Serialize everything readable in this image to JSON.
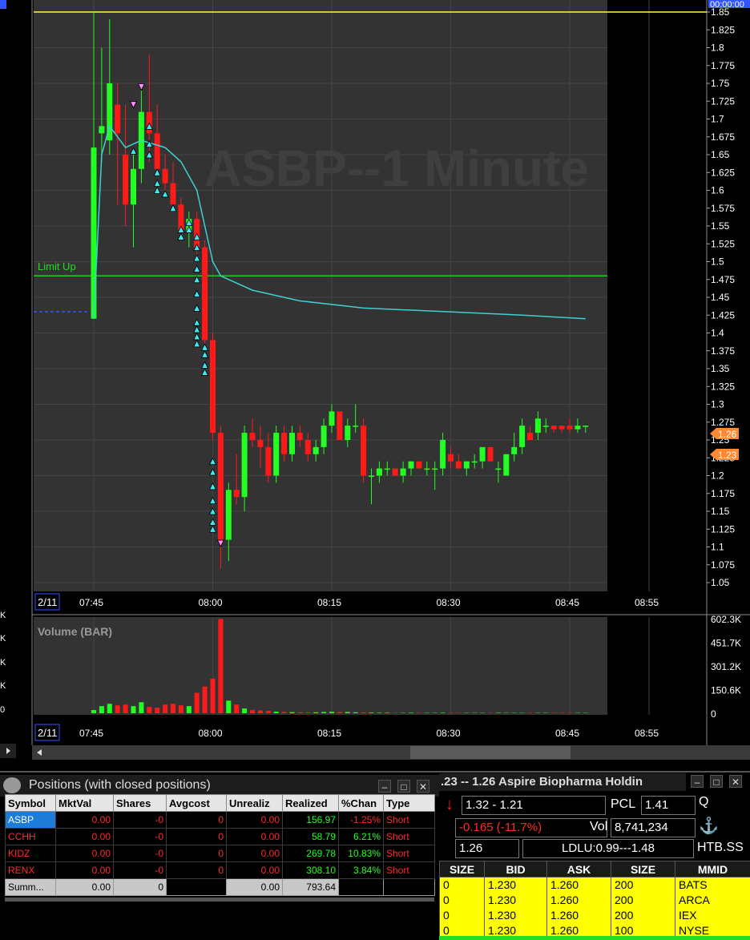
{
  "chart": {
    "title_watermark": "ASBP--1 Minute",
    "top_timestamp": "00:00:00",
    "date_label": "2/11",
    "limit_up_label": "Limit Up",
    "limit_up_price": 1.48,
    "top_yellow_price": 1.85,
    "time_labels": [
      "07:45",
      "08:00",
      "08:15",
      "08:30",
      "08:45",
      "08:55"
    ],
    "price_ticks": [
      "1.85",
      "1.825",
      "1.8",
      "1.775",
      "1.75",
      "1.725",
      "1.7",
      "1.675",
      "1.65",
      "1.625",
      "1.6",
      "1.575",
      "1.55",
      "1.525",
      "1.5",
      "1.475",
      "1.45",
      "1.425",
      "1.4",
      "1.375",
      "1.35",
      "1.325",
      "1.3",
      "1.275",
      "1.25",
      "1.225",
      "1.2",
      "1.175",
      "1.15",
      "1.125",
      "1.1",
      "1.075",
      "1.05"
    ],
    "bid_tag": "1.26",
    "ask_tag": "1.23",
    "volume_label": "Volume (BAR)",
    "volume_ticks": [
      "602.3K",
      "451.7K",
      "301.2K",
      "150.6K",
      "0"
    ],
    "left_edge_labels": [
      "K",
      "K",
      "K",
      "K",
      "0"
    ],
    "colors": {
      "up": "#22ff22",
      "down": "#ff1a1a",
      "vwap": "#40d0d0",
      "limit": "#22cc22",
      "yellow": "#ffff33",
      "bg": "#333333"
    }
  },
  "chart_data": {
    "type": "candlestick",
    "x_unit": "minutes after 07:45",
    "candles": [
      {
        "x": 0,
        "o": 1.42,
        "h": 1.85,
        "l": 1.42,
        "c": 1.66
      },
      {
        "x": 1,
        "o": 1.68,
        "h": 1.8,
        "l": 1.64,
        "c": 1.69
      },
      {
        "x": 2,
        "o": 1.67,
        "h": 1.84,
        "l": 1.65,
        "c": 1.75
      },
      {
        "x": 3,
        "o": 1.72,
        "h": 1.75,
        "l": 1.58,
        "c": 1.68
      },
      {
        "x": 4,
        "o": 1.65,
        "h": 1.72,
        "l": 1.55,
        "c": 1.58
      },
      {
        "x": 5,
        "o": 1.58,
        "h": 1.65,
        "l": 1.52,
        "c": 1.63
      },
      {
        "x": 6,
        "o": 1.63,
        "h": 1.74,
        "l": 1.61,
        "c": 1.71
      },
      {
        "x": 7,
        "o": 1.71,
        "h": 1.79,
        "l": 1.64,
        "c": 1.68
      },
      {
        "x": 8,
        "o": 1.68,
        "h": 1.72,
        "l": 1.62,
        "c": 1.63
      },
      {
        "x": 9,
        "o": 1.63,
        "h": 1.65,
        "l": 1.59,
        "c": 1.61
      },
      {
        "x": 10,
        "o": 1.61,
        "h": 1.64,
        "l": 1.57,
        "c": 1.58
      },
      {
        "x": 11,
        "o": 1.58,
        "h": 1.59,
        "l": 1.53,
        "c": 1.54
      },
      {
        "x": 12,
        "o": 1.54,
        "h": 1.57,
        "l": 1.52,
        "c": 1.56
      },
      {
        "x": 13,
        "o": 1.56,
        "h": 1.57,
        "l": 1.51,
        "c": 1.52
      },
      {
        "x": 14,
        "o": 1.52,
        "h": 1.53,
        "l": 1.38,
        "c": 1.39
      },
      {
        "x": 15,
        "o": 1.39,
        "h": 1.4,
        "l": 1.25,
        "c": 1.26
      },
      {
        "x": 16,
        "o": 1.26,
        "h": 1.27,
        "l": 1.07,
        "c": 1.11
      },
      {
        "x": 17,
        "o": 1.11,
        "h": 1.19,
        "l": 1.08,
        "c": 1.18
      },
      {
        "x": 18,
        "o": 1.18,
        "h": 1.23,
        "l": 1.16,
        "c": 1.17
      },
      {
        "x": 19,
        "o": 1.17,
        "h": 1.27,
        "l": 1.15,
        "c": 1.26
      },
      {
        "x": 20,
        "o": 1.26,
        "h": 1.28,
        "l": 1.24,
        "c": 1.25
      },
      {
        "x": 21,
        "o": 1.25,
        "h": 1.27,
        "l": 1.21,
        "c": 1.24
      },
      {
        "x": 22,
        "o": 1.24,
        "h": 1.26,
        "l": 1.19,
        "c": 1.2
      },
      {
        "x": 23,
        "o": 1.2,
        "h": 1.27,
        "l": 1.19,
        "c": 1.26
      },
      {
        "x": 24,
        "o": 1.26,
        "h": 1.27,
        "l": 1.22,
        "c": 1.23
      },
      {
        "x": 25,
        "o": 1.23,
        "h": 1.27,
        "l": 1.22,
        "c": 1.26
      },
      {
        "x": 26,
        "o": 1.26,
        "h": 1.27,
        "l": 1.24,
        "c": 1.25
      },
      {
        "x": 27,
        "o": 1.25,
        "h": 1.26,
        "l": 1.22,
        "c": 1.23
      },
      {
        "x": 28,
        "o": 1.23,
        "h": 1.25,
        "l": 1.22,
        "c": 1.24
      },
      {
        "x": 29,
        "o": 1.24,
        "h": 1.28,
        "l": 1.23,
        "c": 1.27
      },
      {
        "x": 30,
        "o": 1.27,
        "h": 1.3,
        "l": 1.26,
        "c": 1.29
      },
      {
        "x": 31,
        "o": 1.29,
        "h": 1.29,
        "l": 1.25,
        "c": 1.25
      },
      {
        "x": 32,
        "o": 1.25,
        "h": 1.28,
        "l": 1.24,
        "c": 1.27
      },
      {
        "x": 33,
        "o": 1.27,
        "h": 1.3,
        "l": 1.26,
        "c": 1.27
      },
      {
        "x": 34,
        "o": 1.27,
        "h": 1.28,
        "l": 1.19,
        "c": 1.2
      },
      {
        "x": 35,
        "o": 1.2,
        "h": 1.21,
        "l": 1.16,
        "c": 1.2
      },
      {
        "x": 36,
        "o": 1.2,
        "h": 1.22,
        "l": 1.19,
        "c": 1.21
      },
      {
        "x": 37,
        "o": 1.21,
        "h": 1.22,
        "l": 1.2,
        "c": 1.21
      },
      {
        "x": 38,
        "o": 1.21,
        "h": 1.21,
        "l": 1.2,
        "c": 1.2
      },
      {
        "x": 39,
        "o": 1.2,
        "h": 1.22,
        "l": 1.19,
        "c": 1.21
      },
      {
        "x": 40,
        "o": 1.21,
        "h": 1.22,
        "l": 1.2,
        "c": 1.22
      },
      {
        "x": 41,
        "o": 1.22,
        "h": 1.22,
        "l": 1.21,
        "c": 1.21
      },
      {
        "x": 42,
        "o": 1.21,
        "h": 1.22,
        "l": 1.2,
        "c": 1.21
      },
      {
        "x": 43,
        "o": 1.21,
        "h": 1.22,
        "l": 1.18,
        "c": 1.21
      },
      {
        "x": 44,
        "o": 1.21,
        "h": 1.26,
        "l": 1.2,
        "c": 1.25
      },
      {
        "x": 45,
        "o": 1.23,
        "h": 1.24,
        "l": 1.21,
        "c": 1.22
      },
      {
        "x": 46,
        "o": 1.22,
        "h": 1.23,
        "l": 1.21,
        "c": 1.21
      },
      {
        "x": 47,
        "o": 1.21,
        "h": 1.22,
        "l": 1.2,
        "c": 1.22
      },
      {
        "x": 48,
        "o": 1.22,
        "h": 1.23,
        "l": 1.21,
        "c": 1.22
      },
      {
        "x": 49,
        "o": 1.22,
        "h": 1.24,
        "l": 1.21,
        "c": 1.24
      },
      {
        "x": 50,
        "o": 1.24,
        "h": 1.24,
        "l": 1.22,
        "c": 1.22
      },
      {
        "x": 51,
        "o": 1.21,
        "h": 1.22,
        "l": 1.19,
        "c": 1.21
      },
      {
        "x": 52,
        "o": 1.2,
        "h": 1.23,
        "l": 1.2,
        "c": 1.23
      },
      {
        "x": 53,
        "o": 1.23,
        "h": 1.26,
        "l": 1.22,
        "c": 1.24
      },
      {
        "x": 54,
        "o": 1.24,
        "h": 1.28,
        "l": 1.23,
        "c": 1.27
      },
      {
        "x": 55,
        "o": 1.26,
        "h": 1.27,
        "l": 1.25,
        "c": 1.25
      },
      {
        "x": 56,
        "o": 1.26,
        "h": 1.29,
        "l": 1.25,
        "c": 1.28
      },
      {
        "x": 57,
        "o": 1.27,
        "h": 1.28,
        "l": 1.26,
        "c": 1.27
      },
      {
        "x": 58,
        "o": 1.27,
        "h": 1.27,
        "l": 1.26,
        "c": 1.265
      },
      {
        "x": 59,
        "o": 1.27,
        "h": 1.27,
        "l": 1.26,
        "c": 1.265
      },
      {
        "x": 60,
        "o": 1.27,
        "h": 1.28,
        "l": 1.26,
        "c": 1.265
      },
      {
        "x": 61,
        "o": 1.265,
        "h": 1.28,
        "l": 1.26,
        "c": 1.27
      },
      {
        "x": 62,
        "o": 1.27,
        "h": 1.27,
        "l": 1.26,
        "c": 1.27
      }
    ],
    "vwap": [
      [
        0,
        1.42
      ],
      [
        1,
        1.65
      ],
      [
        2,
        1.69
      ],
      [
        4,
        1.66
      ],
      [
        6,
        1.67
      ],
      [
        9,
        1.66
      ],
      [
        11,
        1.64
      ],
      [
        13,
        1.6
      ],
      [
        14,
        1.55
      ],
      [
        15,
        1.5
      ],
      [
        16,
        1.48
      ],
      [
        20,
        1.46
      ],
      [
        26,
        1.445
      ],
      [
        34,
        1.435
      ],
      [
        44,
        1.43
      ],
      [
        54,
        1.425
      ],
      [
        62,
        1.42
      ]
    ],
    "volume_k": [
      20,
      45,
      60,
      50,
      55,
      45,
      70,
      40,
      35,
      55,
      60,
      50,
      45,
      130,
      170,
      220,
      600,
      80,
      55,
      30,
      20,
      18,
      15,
      10,
      8,
      7,
      6,
      5,
      6,
      8,
      9,
      7,
      8,
      6,
      5,
      4,
      3,
      3,
      2,
      2,
      3,
      2,
      2,
      2,
      3,
      2,
      2,
      2,
      2,
      2,
      2,
      3,
      2,
      2,
      2,
      2,
      2,
      2,
      2,
      2,
      2,
      2,
      2
    ],
    "ylim": [
      1.05,
      1.85
    ],
    "volume_ylim": [
      0,
      602.3
    ]
  },
  "positions": {
    "title": "Positions (with closed positions)",
    "headers": [
      "Symbol",
      "MktVal",
      "Shares",
      "Avgcost",
      "Unrealiz",
      "Realized",
      "%Chan",
      "Type"
    ],
    "rows": [
      [
        "ASBP",
        "0.00",
        "-0",
        "0",
        "0.00",
        "156.97",
        "-1.25%",
        "Short"
      ],
      [
        "CCHH",
        "0.00",
        "-0",
        "0",
        "0.00",
        "58.79",
        "6.21%",
        "Short"
      ],
      [
        "KIDZ",
        "0.00",
        "-0",
        "0",
        "0.00",
        "269.78",
        "10.83%",
        "Short"
      ],
      [
        "RENX",
        "0.00",
        "-0",
        "0",
        "0.00",
        "308.10",
        "3.84%",
        "Short"
      ]
    ],
    "summary": [
      "Summ...",
      "0.00",
      "0",
      "",
      "0.00",
      "793.64",
      "",
      ""
    ]
  },
  "level2": {
    "title": ".23 -- 1.26   Aspire Biopharma Holdin",
    "range": "1.32 - 1.21",
    "pcl_label": "PCL",
    "pcl_value": "1.41",
    "q_label": "Q",
    "change": "-0.165   (-11.7%)",
    "vol_label": "Vol",
    "vol_value": "8,741,234",
    "last": "1.26",
    "ldlu": "LDLU:0.99---1.48",
    "htb": "HTB.SS",
    "headers": [
      "SIZE",
      "BID",
      "ASK",
      "SIZE",
      "MMID"
    ],
    "rows": [
      [
        "0",
        "1.230",
        "1.260",
        "200",
        "BATS"
      ],
      [
        "0",
        "1.230",
        "1.260",
        "200",
        "ARCA"
      ],
      [
        "0",
        "1.230",
        "1.260",
        "200",
        "IEX"
      ],
      [
        "0",
        "1.230",
        "1.260",
        "100",
        "NYSE"
      ]
    ]
  }
}
